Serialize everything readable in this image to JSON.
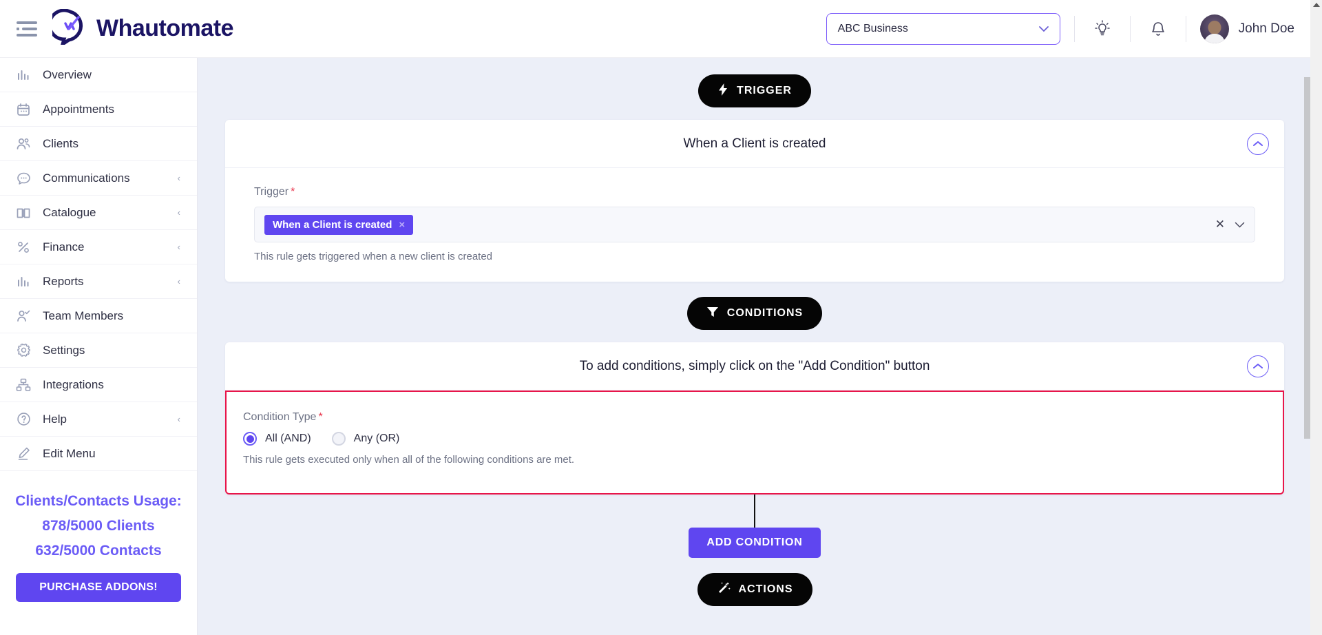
{
  "header": {
    "brand": "Whautomate",
    "menu_icon": "hamburger-icon",
    "business_selector": {
      "value": "ABC Business",
      "caret": "⌄"
    },
    "tips_icon": "lightbulb-icon",
    "notifications_icon": "bell-icon",
    "username": "John Doe"
  },
  "sidebar": {
    "items": [
      {
        "label": "Overview",
        "icon": "bar-chart-icon",
        "expandable": false
      },
      {
        "label": "Appointments",
        "icon": "calendar-icon",
        "expandable": false
      },
      {
        "label": "Clients",
        "icon": "users-icon",
        "expandable": false
      },
      {
        "label": "Communications",
        "icon": "chat-bubble-icon",
        "expandable": true
      },
      {
        "label": "Catalogue",
        "icon": "book-icon",
        "expandable": true
      },
      {
        "label": "Finance",
        "icon": "percent-icon",
        "expandable": true
      },
      {
        "label": "Reports",
        "icon": "bar-chart-icon",
        "expandable": true
      },
      {
        "label": "Team Members",
        "icon": "user-check-icon",
        "expandable": false
      },
      {
        "label": "Settings",
        "icon": "gear-icon",
        "expandable": false
      },
      {
        "label": "Integrations",
        "icon": "sitemap-icon",
        "expandable": false
      },
      {
        "label": "Help",
        "icon": "question-circle-icon",
        "expandable": true
      },
      {
        "label": "Edit Menu",
        "icon": "pencil-icon",
        "expandable": false
      }
    ],
    "usage": {
      "title": "Clients/Contacts Usage:",
      "clients": "878/5000 Clients",
      "contacts": "632/5000 Contacts",
      "purchase_label": "PURCHASE ADDONS!"
    },
    "chevron": "‹"
  },
  "workflow": {
    "trigger_pill": {
      "label": "TRIGGER",
      "icon": "lightning-bolt-icon"
    },
    "trigger_card": {
      "title": "When a Client is created",
      "collapse_icon": "chevron-up-icon",
      "field_label": "Trigger",
      "required_mark": "*",
      "chip": "When a Client is created",
      "chip_clear": "×",
      "clear_icon": "✕",
      "dropdown_icon": "⌄",
      "helper": "This rule gets triggered when a new client is created"
    },
    "conditions_pill": {
      "label": "CONDITIONS",
      "icon": "filter-icon"
    },
    "conditions_card": {
      "title": "To add conditions, simply click on the \"Add Condition\" button",
      "collapse_icon": "chevron-up-icon",
      "field_label": "Condition Type",
      "required_mark": "*",
      "options": [
        {
          "label": "All (AND)",
          "selected": true
        },
        {
          "label": "Any (OR)",
          "selected": false
        }
      ],
      "helper": "This rule gets executed only when all of the following conditions are met."
    },
    "add_condition_label": "ADD CONDITION",
    "actions_pill": {
      "label": "ACTIONS",
      "icon": "magic-wand-icon"
    }
  },
  "colors": {
    "brand_purple": "#5f46f0",
    "brand_navy": "#1b1464",
    "pill_black": "#050505",
    "highlight_pink": "#e8154a",
    "page_bg": "#eceff8"
  }
}
